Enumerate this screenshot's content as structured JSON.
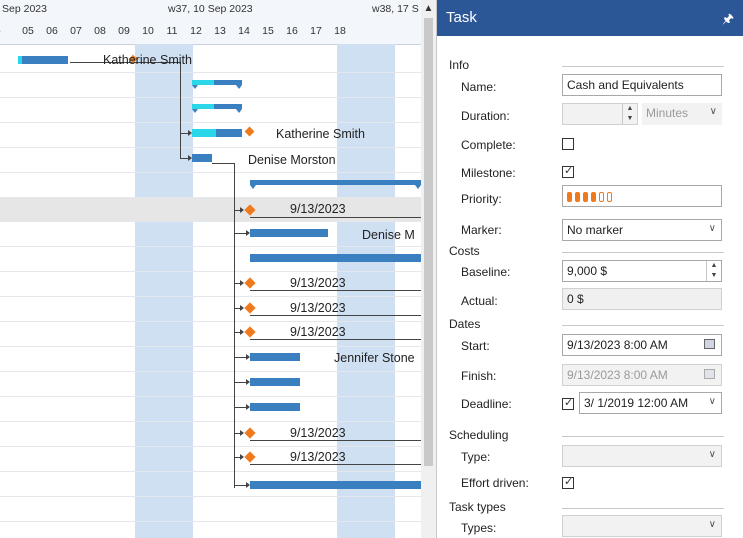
{
  "timeline": {
    "weeks": [
      "Sep 2023",
      "w37, 10 Sep 2023",
      "w38, 17 S"
    ],
    "days": [
      "05",
      "06",
      "07",
      "08",
      "09",
      "10",
      "11",
      "12",
      "13",
      "14",
      "15",
      "16",
      "17",
      "18"
    ],
    "scroll_up_icon": "chevron-up-icon"
  },
  "gantt_labels": {
    "r0": "Katherine Smith",
    "r4": "Katherine Smith",
    "r5": "Denise Morston",
    "r7": "9/13/2023",
    "r8": "Denise M",
    "r10": "9/13/2023",
    "r11": "9/13/2023",
    "r12": "9/13/2023",
    "r13": "Jennifer Stone",
    "r16": "9/13/2023",
    "r17": "9/13/2023"
  },
  "panel": {
    "title": "Task",
    "pin_icon": "pin-icon",
    "sections": {
      "info": "Info",
      "costs": "Costs",
      "dates": "Dates",
      "scheduling": "Scheduling",
      "task_types": "Task types"
    },
    "labels": {
      "name": "Name:",
      "duration": "Duration:",
      "complete": "Complete:",
      "milestone": "Milestone:",
      "priority": "Priority:",
      "marker": "Marker:",
      "baseline": "Baseline:",
      "actual": "Actual:",
      "start": "Start:",
      "finish": "Finish:",
      "deadline": "Deadline:",
      "type": "Type:",
      "effort_driven": "Effort driven:",
      "types": "Types:"
    },
    "values": {
      "name": "Cash and Equivalents",
      "duration_unit": "Minutes",
      "marker": "No marker",
      "baseline": "9,000 $",
      "actual": "0 $",
      "start": "9/13/2023  8:00 AM",
      "finish": "9/13/2023  8:00 AM",
      "deadline": "3/  1/2019 12:00 AM"
    },
    "state": {
      "complete": false,
      "milestone": true,
      "deadline_enabled": true,
      "effort_driven": true,
      "priority_level": 4,
      "priority_max": 6
    },
    "colors": {
      "title_bar": "#2b5797",
      "priority": "#ef7a1d",
      "task_bar": "#3a7fc0",
      "progress": "#2ad7e8",
      "milestone": "#ef7a1d"
    }
  }
}
